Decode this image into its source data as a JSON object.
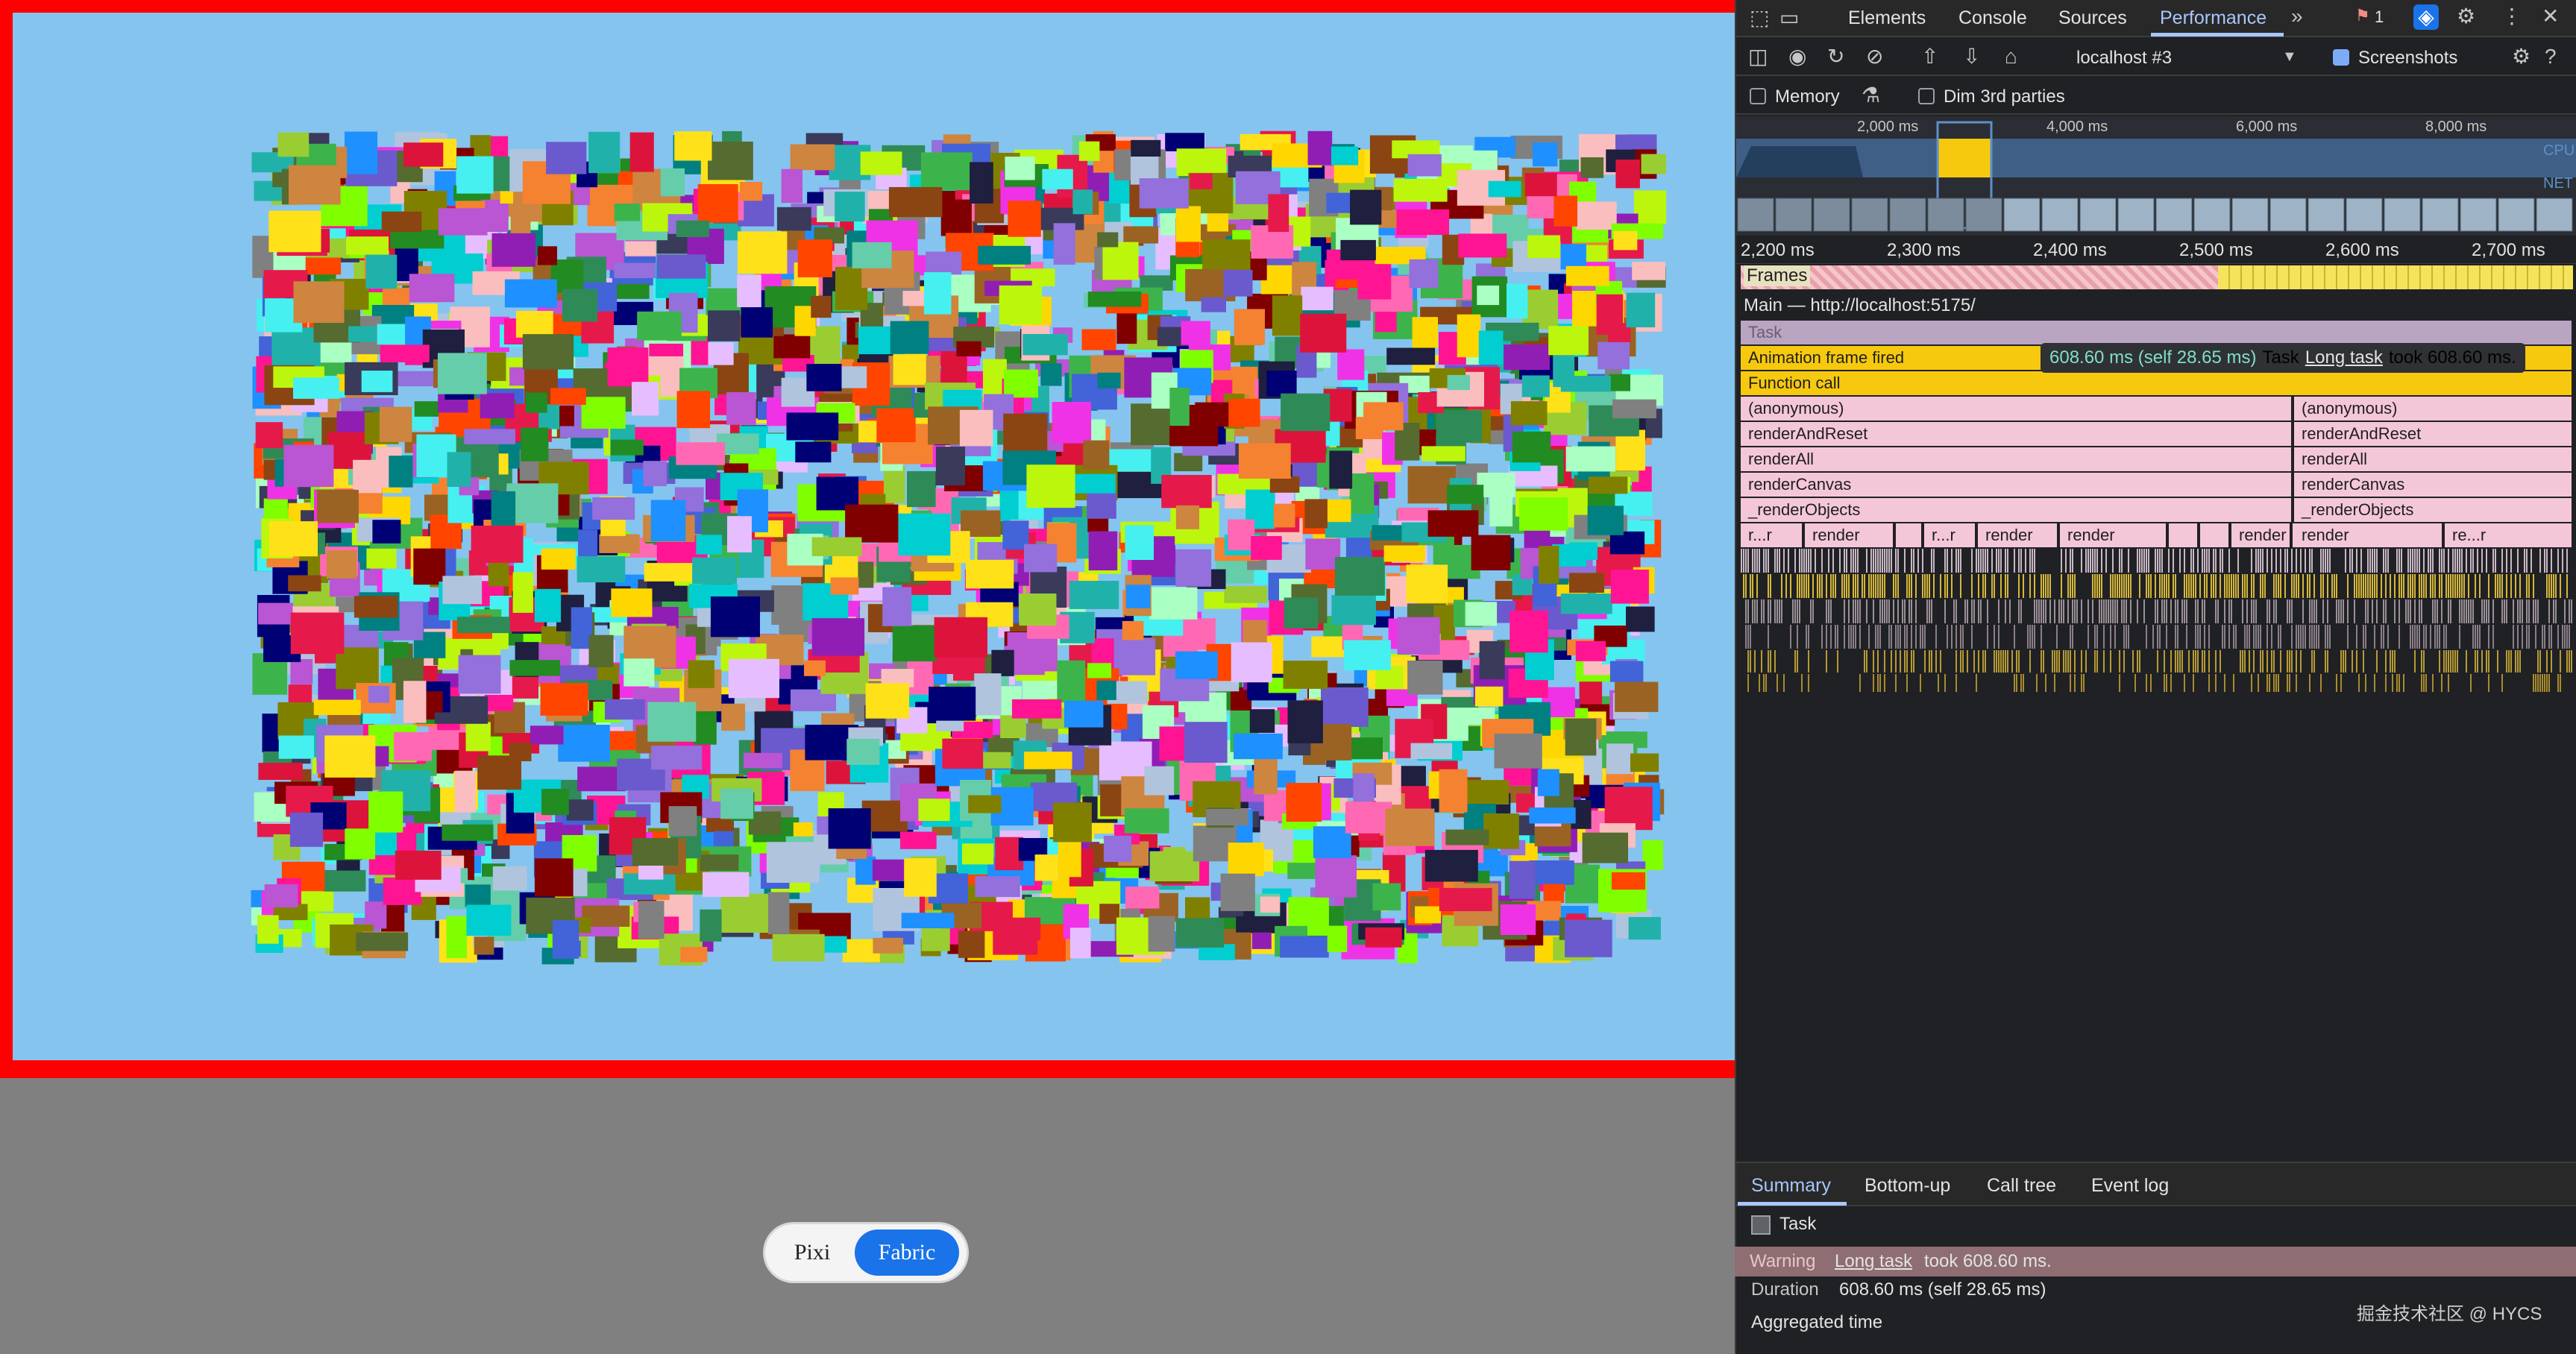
{
  "app": {
    "toggle": {
      "options": [
        "Pixi",
        "Fabric"
      ],
      "selected": "Fabric"
    }
  },
  "devtools": {
    "tabs": [
      "Elements",
      "Console",
      "Sources",
      "Performance"
    ],
    "active_tab": "Performance",
    "issues_count": "1",
    "recording_target": "localhost #3",
    "screenshots_label": "Screenshots",
    "screenshots_checked": true,
    "memory_label": "Memory",
    "dim_label": "Dim 3rd parties",
    "overview": {
      "ticks": [
        "2,000 ms",
        "4,000 ms",
        "6,000 ms",
        "8,000 ms"
      ],
      "cpu_label": "CPU",
      "net_label": "NET"
    },
    "timeline_ticks": [
      "2,200 ms",
      "2,300 ms",
      "2,400 ms",
      "2,500 ms",
      "2,600 ms",
      "2,700 ms"
    ],
    "frames_label": "Frames",
    "main_label": "Main — http://localhost:5175/",
    "flame": {
      "task": "Task",
      "animation_frame": "Animation frame fired",
      "function_call": "Function call",
      "stack_left": [
        "(anonymous)",
        "renderAndReset",
        "renderAll",
        "renderCanvas",
        "_renderObjects"
      ],
      "stack_right": [
        "(anonymous)",
        "renderAndReset",
        "renderAll",
        "renderCanvas",
        "_renderObjects"
      ],
      "render_row": [
        "r...r",
        "render",
        "r...r",
        "render",
        "render",
        "render",
        "render",
        "re...r"
      ]
    },
    "tooltip": {
      "time": "608.60 ms (self 28.65 ms)",
      "task": "Task",
      "link": "Long task",
      "rest": "took 608.60 ms."
    },
    "bottom_tabs": [
      "Summary",
      "Bottom-up",
      "Call tree",
      "Event log"
    ],
    "active_bottom_tab": "Summary",
    "summary": {
      "title": "Task",
      "warning_key": "Warning",
      "warning_link": "Long task",
      "warning_rest": "took 608.60 ms.",
      "duration_key": "Duration",
      "duration_value": "608.60 ms (self 28.65 ms)",
      "aggregated": "Aggregated time"
    },
    "watermark": "掘金技术社区 @ HYCS"
  }
}
